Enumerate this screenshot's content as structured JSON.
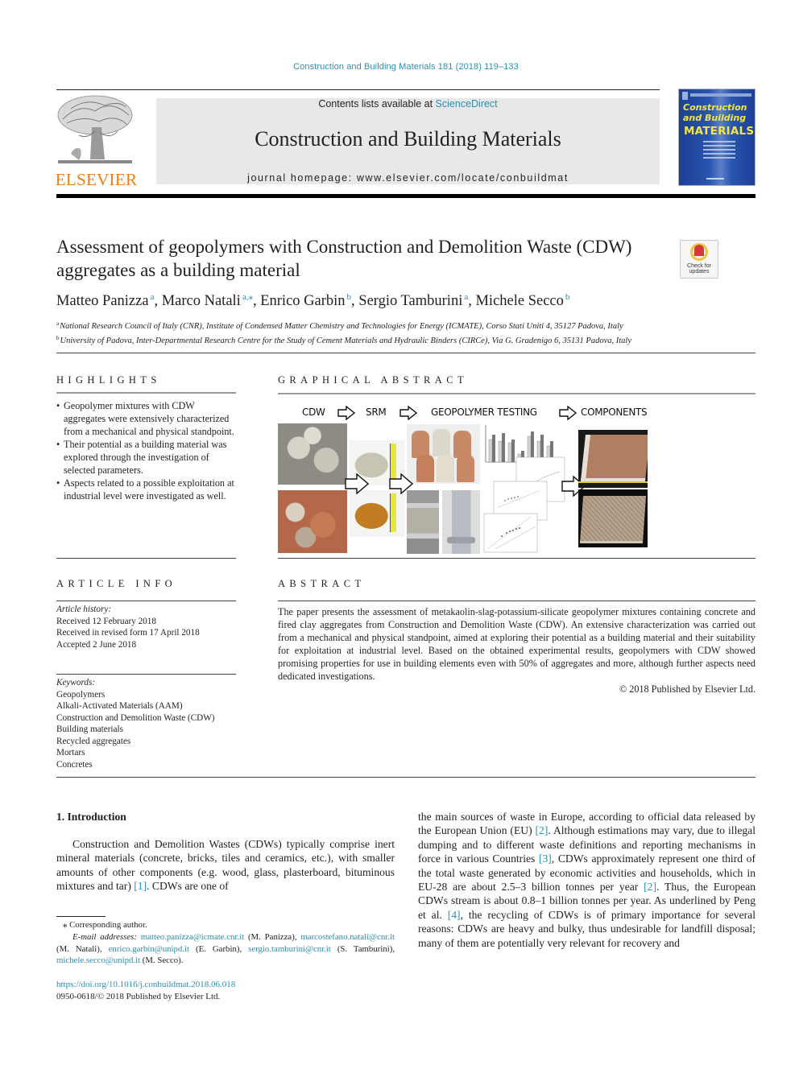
{
  "header": {
    "journal_ref": "Construction and Building Materials 181 (2018) 119–133",
    "contents_prefix": "Contents lists available at ",
    "contents_link": "ScienceDirect",
    "journal_title": "Construction and Building Materials",
    "homepage_prefix": "journal homepage: ",
    "homepage_url": "www.elsevier.com/locate/conbuildmat",
    "publisher_logo_text": "ELSEVIER",
    "cover": {
      "line1": "Construction",
      "line2": "and Building",
      "line3": "MATERIALS"
    },
    "colors": {
      "link": "#2b8fb3",
      "elsevier_orange": "#f07d12",
      "cover_blue": "#2955b0",
      "cover_yellow": "#f3e83a"
    }
  },
  "article": {
    "title": "Assessment of geopolymers with Construction and Demolition Waste (CDW) aggregates as a building material",
    "check_updates": {
      "line1": "Check for",
      "line2": "updates"
    },
    "authors": [
      {
        "name": "Matteo Panizza",
        "affil": "a"
      },
      {
        "name": "Marco Natali",
        "affil": "a,⁎"
      },
      {
        "name": "Enrico Garbin",
        "affil": "b"
      },
      {
        "name": "Sergio Tamburini",
        "affil": "a"
      },
      {
        "name": "Michele Secco",
        "affil": "b"
      }
    ],
    "affiliations": [
      {
        "mark": "a",
        "text": "National Research Council of Italy (CNR), Institute of Condensed Matter Chemistry and Technologies for Energy (ICMATE), Corso Stati Uniti 4, 35127 Padova, Italy"
      },
      {
        "mark": "b",
        "text": "University of Padova, Inter-Departmental Research Centre for the Study of Cement Materials and Hydraulic Binders (CIRCe), Via G. Gradenigo 6, 35131 Padova, Italy"
      }
    ]
  },
  "highlights": {
    "heading": "HIGHLIGHTS",
    "items": [
      "Geopolymer mixtures with CDW aggregates were extensively characterized from a mechanical and physical standpoint.",
      "Their potential as a building material was explored through the investigation of selected parameters.",
      "Aspects related to a possible exploitation at industrial level were investigated as well."
    ]
  },
  "graphical_abstract": {
    "heading": "GRAPHICAL ABSTRACT",
    "stages": [
      "CDW",
      "SRM",
      "GEOPOLYMER TESTING",
      "COMPONENTS"
    ]
  },
  "article_info": {
    "heading": "ARTICLE INFO",
    "history_label": "Article history:",
    "history": [
      "Received 12 February 2018",
      "Received in revised form 17 April 2018",
      "Accepted 2 June 2018"
    ],
    "keywords_label": "Keywords:",
    "keywords": [
      "Geopolymers",
      "Alkali-Activated Materials (AAM)",
      "Construction and Demolition Waste (CDW)",
      "Building materials",
      "Recycled aggregates",
      "Mortars",
      "Concretes"
    ]
  },
  "abstract": {
    "heading": "ABSTRACT",
    "text": "The paper presents the assessment of metakaolin-slag-potassium-silicate geopolymer mixtures containing concrete and fired clay aggregates from Construction and Demolition Waste (CDW). An extensive characterization was carried out from a mechanical and physical standpoint, aimed at exploring their potential as a building material and their suitability for exploitation at industrial level. Based on the obtained experimental results, geopolymers with CDW showed promising properties for use in building elements even with 50% of aggregates and more, although further aspects need dedicated investigations.",
    "copyright": "© 2018 Published by Elsevier Ltd."
  },
  "introduction": {
    "heading": "1. Introduction",
    "left": {
      "p1": "Construction and Demolition Wastes (CDWs) typically comprise inert mineral materials (concrete, bricks, tiles and ceramics, etc.), with smaller amounts of other components (e.g. wood, glass, plasterboard, bituminous mixtures and tar) ",
      "ref1": "[1]",
      "p1_end": ". CDWs are one of"
    },
    "right": {
      "s1": "the main sources of waste in Europe, according to official data released by the European Union (EU) ",
      "ref2": "[2]",
      "s2": ". Although estimations may vary, due to illegal dumping and to different waste definitions and reporting mechanisms in force in various Countries ",
      "ref3": "[3]",
      "s3": ", CDWs approximately represent one third of the total waste generated by economic activities and households, which in EU-28 are about 2.5–3 billion tonnes per year ",
      "ref2b": "[2]",
      "s4": ". Thus, the European CDWs stream is about 0.8–1 billion tonnes per year. As underlined by Peng et al. ",
      "ref4": "[4]",
      "s5": ", the recycling of CDWs is of primary importance for several reasons: CDWs are heavy and bulky, thus undesirable for landfill disposal; many of them are potentially very relevant for recovery and"
    }
  },
  "footnotes": {
    "corresponding": "⁎ Corresponding author.",
    "email_label": "E-mail addresses: ",
    "emails": [
      {
        "addr": "matteo.panizza@icmate.cnr.it",
        "who": " (M. Panizza), "
      },
      {
        "addr": "marcostefano.natali@cnr.it",
        "who": " (M. Natali), "
      },
      {
        "addr": "enrico.garbin@unipd.it",
        "who": " (E. Garbin), "
      },
      {
        "addr": "sergio.tamburini@cnr.it",
        "who": " (S. Tamburini), "
      },
      {
        "addr": "michele.secco@unipd.it",
        "who": " (M. Secco)."
      }
    ],
    "doi": "https://doi.org/10.1016/j.conbuildmat.2018.06.018",
    "issn": "0950-0618/© 2018 Published by Elsevier Ltd."
  }
}
